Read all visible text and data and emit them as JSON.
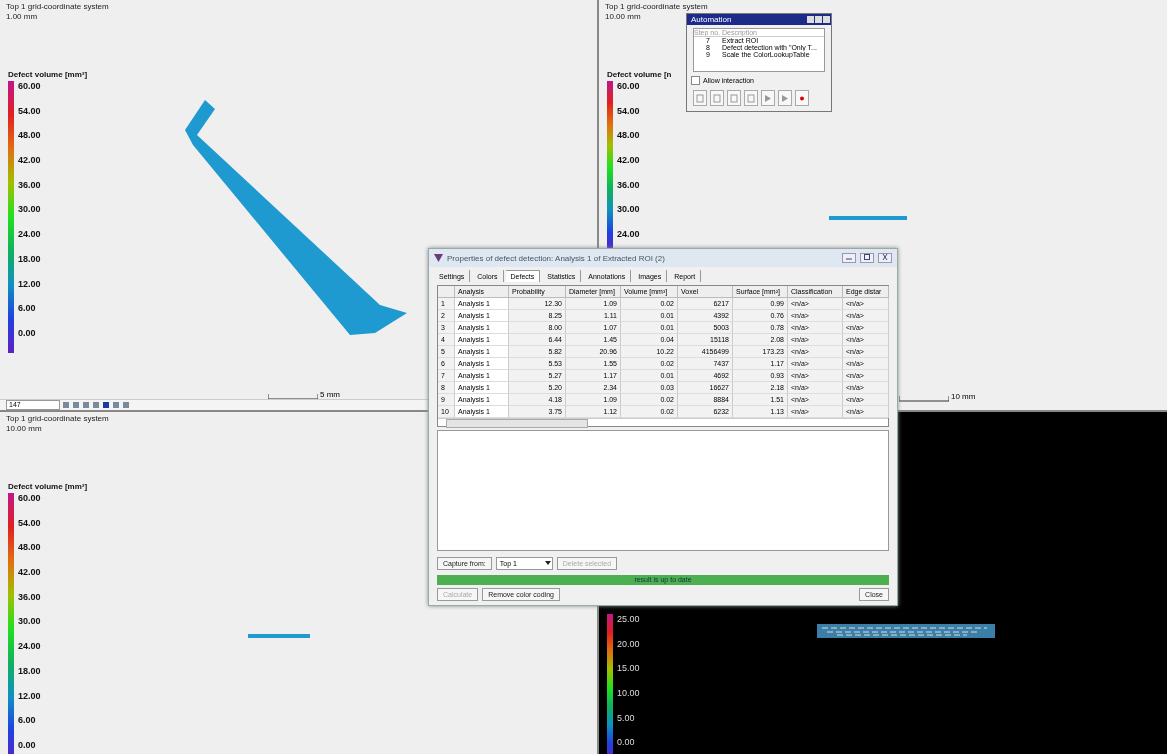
{
  "viewports": [
    {
      "title": "Top 1 grid-coordinate system",
      "subtitle": "1.00 mm",
      "dark": false,
      "legend": {
        "title": "Defect volume [mm³]",
        "ticks": [
          "60.00",
          "54.00",
          "48.00",
          "42.00",
          "36.00",
          "30.00",
          "24.00",
          "18.00",
          "12.00",
          "6.00",
          "0.00"
        ]
      },
      "scale_bar": "5 mm",
      "toolbar": {
        "value": "147"
      }
    },
    {
      "title": "Top 1 grid-coordinate system",
      "subtitle": "10.00 mm",
      "dark": false,
      "legend": {
        "title": "Defect volume [n",
        "ticks": [
          "60.00",
          "54.00",
          "48.00",
          "42.00",
          "36.00",
          "30.00",
          "24.00"
        ]
      },
      "scale_bar": "10 mm"
    },
    {
      "title": "Top 1 grid-coordinate system",
      "subtitle": "10.00 mm",
      "dark": false,
      "legend": {
        "title": "Defect volume [mm³]",
        "ticks": [
          "60.00",
          "54.00",
          "48.00",
          "42.00",
          "36.00",
          "30.00",
          "24.00",
          "18.00",
          "12.00",
          "6.00",
          "0.00"
        ]
      }
    },
    {
      "dark": true,
      "legend": {
        "ticks": [
          "25.00",
          "20.00",
          "15.00",
          "10.00",
          "5.00",
          "0.00"
        ]
      }
    }
  ],
  "automation": {
    "title": "Automation",
    "columns": [
      "Step no.",
      "Description"
    ],
    "steps": [
      {
        "no": "7",
        "description": "Extract ROI"
      },
      {
        "no": "8",
        "description": "Defect detection with \"Only T..."
      },
      {
        "no": "9",
        "description": "Scale the ColorLookupTable"
      }
    ],
    "allow_interaction": {
      "label": "Allow interaction",
      "checked": false
    }
  },
  "dialog": {
    "title": "Properties of defect detection: Analysis 1 of Extracted ROI (2)",
    "tabs": [
      {
        "label": "Settings",
        "selected": false
      },
      {
        "label": "Colors",
        "selected": false
      },
      {
        "label": "Defects",
        "selected": true
      },
      {
        "label": "Statistics",
        "selected": false
      },
      {
        "label": "Annotations",
        "selected": false
      },
      {
        "label": "Images",
        "selected": false
      },
      {
        "label": "Report",
        "selected": false
      }
    ],
    "columns": [
      "",
      "Analysis",
      "Probability",
      "Diameter [mm]",
      "Volume [mm³]",
      "Voxel",
      "Surface [mm²]",
      "Classification",
      "Edge distar"
    ],
    "rows": [
      [
        "1",
        "Analysis 1",
        "12.30",
        "1.09",
        "0.02",
        "6217",
        "0.99",
        "<n/a>",
        "<n/a>"
      ],
      [
        "2",
        "Analysis 1",
        "8.25",
        "1.11",
        "0.01",
        "4392",
        "0.76",
        "<n/a>",
        "<n/a>"
      ],
      [
        "3",
        "Analysis 1",
        "8.00",
        "1.07",
        "0.01",
        "5003",
        "0.78",
        "<n/a>",
        "<n/a>"
      ],
      [
        "4",
        "Analysis 1",
        "6.44",
        "1.45",
        "0.04",
        "15118",
        "2.08",
        "<n/a>",
        "<n/a>"
      ],
      [
        "5",
        "Analysis 1",
        "5.82",
        "20.96",
        "10.22",
        "4156499",
        "173.23",
        "<n/a>",
        "<n/a>"
      ],
      [
        "6",
        "Analysis 1",
        "5.53",
        "1.55",
        "0.02",
        "7437",
        "1.17",
        "<n/a>",
        "<n/a>"
      ],
      [
        "7",
        "Analysis 1",
        "5.27",
        "1.17",
        "0.01",
        "4692",
        "0.93",
        "<n/a>",
        "<n/a>"
      ],
      [
        "8",
        "Analysis 1",
        "5.20",
        "2.34",
        "0.03",
        "16627",
        "2.18",
        "<n/a>",
        "<n/a>"
      ],
      [
        "9",
        "Analysis 1",
        "4.18",
        "1.09",
        "0.02",
        "8884",
        "1.51",
        "<n/a>",
        "<n/a>"
      ],
      [
        "10",
        "Analysis 1",
        "3.75",
        "1.12",
        "0.02",
        "6232",
        "1.13",
        "<n/a>",
        "<n/a>"
      ]
    ],
    "capture_button": "Capture from:",
    "capture_source": "Top 1",
    "delete_button": {
      "label": "Delete selected",
      "disabled": true
    },
    "status": "result is up to date",
    "calculate_button": {
      "label": "Calculate",
      "disabled": true
    },
    "remove_button": "Remove color coding",
    "close_button": "Close"
  }
}
